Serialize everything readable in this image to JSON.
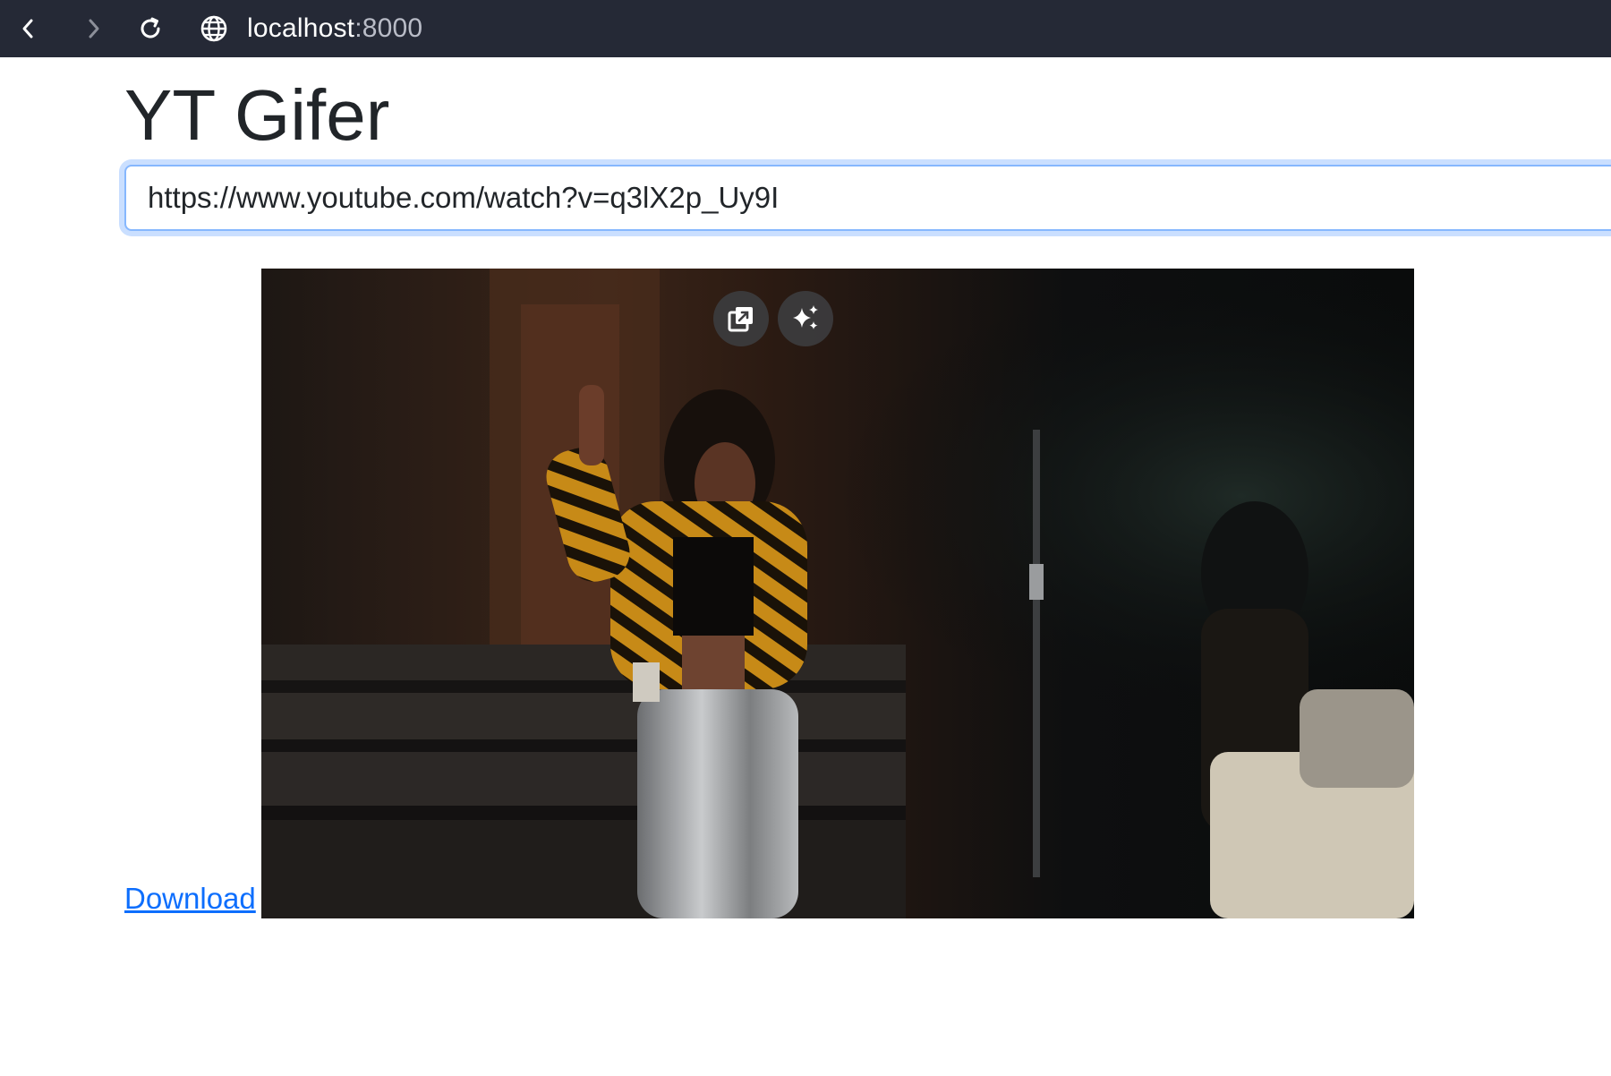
{
  "browser": {
    "host": "localhost",
    "port": ":8000",
    "icons": {
      "back": "chevron-left-icon",
      "forward": "chevron-right-icon",
      "reload": "reload-icon",
      "site": "globe-icon"
    }
  },
  "page": {
    "title": "YT Gifer",
    "url_value": "https://www.youtube.com/watch?v=q3lX2p_Uy9I",
    "download_label": "Download"
  },
  "video": {
    "controls": [
      {
        "icon": "picture-in-picture-icon"
      },
      {
        "icon": "sparkles-icon"
      }
    ]
  },
  "colors": {
    "browser_bar": "#252936",
    "link": "#0d6efd",
    "focus_ring": "#86b7fe",
    "text": "#212529"
  }
}
